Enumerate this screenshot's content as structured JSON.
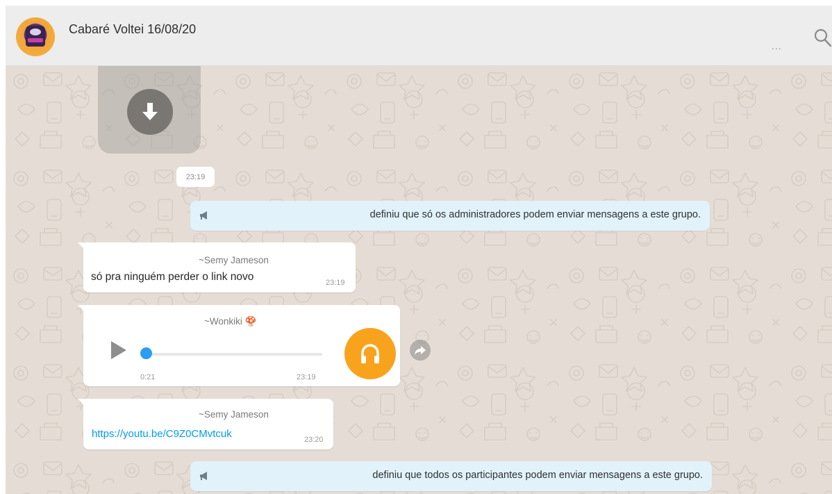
{
  "header": {
    "chat_title": "Cabaré Voltei 16/08/20",
    "menu_label": "...",
    "search_icon": "search-icon"
  },
  "messages": {
    "media": {
      "time": "23:19",
      "icon": "download-icon"
    },
    "system_1": {
      "text": "definiu que só os administradores podem enviar mensagens a este grupo.",
      "icon": "megaphone-icon"
    },
    "text_1": {
      "sender": "~Semy Jameson",
      "text": "só pra ninguém perder o link novo",
      "time": "23:19"
    },
    "audio_1": {
      "sender": "~Wonkiki 🍄",
      "duration": "0:21",
      "time": "23:19",
      "progress": 0.0,
      "icon": "headphones-icon"
    },
    "link_1": {
      "sender": "~Semy Jameson",
      "url": "https://youtu.be/C9Z0CMvtcuk",
      "time": "23:20"
    },
    "system_2": {
      "text": "definiu que todos os participantes podem enviar mensagens a este grupo.",
      "icon": "megaphone-icon"
    }
  },
  "colors": {
    "header_bg": "#ededed",
    "chat_bg": "#e5ddd5",
    "system_bg": "#e1f2fb",
    "link": "#039be5",
    "audio_accent": "#f9a31d",
    "progress_knob": "#2a9df4"
  }
}
